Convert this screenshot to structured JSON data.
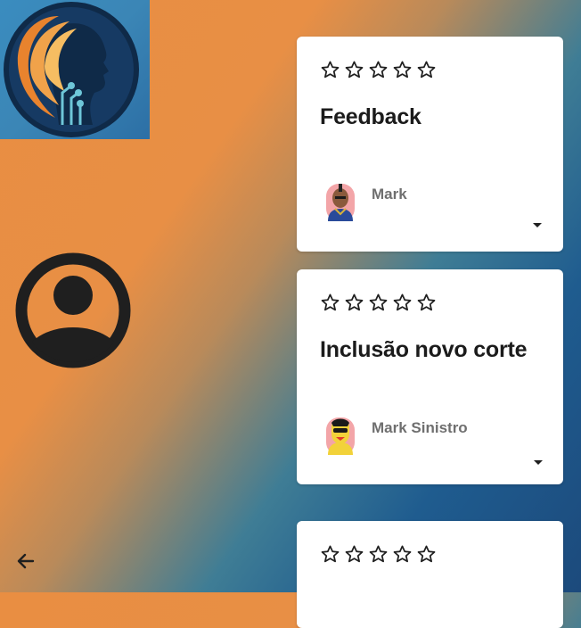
{
  "logo": {
    "icon": "ai-head-logo-icon"
  },
  "profile": {
    "icon": "user-avatar-icon"
  },
  "nav": {
    "back_icon": "arrow-left-icon"
  },
  "cards": [
    {
      "rating": 0,
      "max_rating": 5,
      "title": "Feedback",
      "author": "Mark",
      "expand_icon": "caret-down-icon"
    },
    {
      "rating": 0,
      "max_rating": 5,
      "title": "Inclusão novo corte",
      "author": "Mark Sinistro",
      "expand_icon": "caret-down-icon"
    },
    {
      "rating": 0,
      "max_rating": 5,
      "title": "",
      "author": "",
      "expand_icon": "caret-down-icon"
    }
  ]
}
